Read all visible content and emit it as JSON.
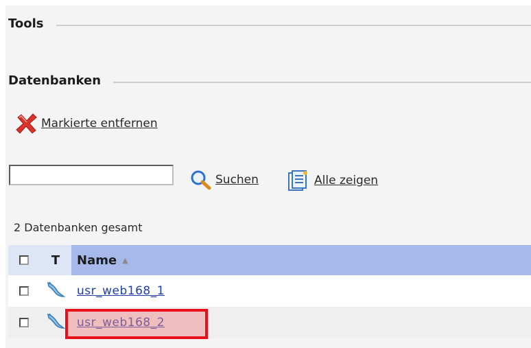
{
  "tools": {
    "title": "Tools"
  },
  "databases": {
    "title": "Datenbanken",
    "remove_label": "Markierte entfernen",
    "search": {
      "value": "",
      "placeholder": ""
    },
    "search_label": "Suchen",
    "show_all_label": "Alle zeigen",
    "count_text": "2 Datenbanken gesamt",
    "table": {
      "header": {
        "type": "T",
        "name": "Name",
        "sort": "▲"
      },
      "rows": [
        {
          "name": "usr_web168_1",
          "selected": false,
          "highlighted": false
        },
        {
          "name": "usr_web168_2",
          "selected": false,
          "highlighted": true
        }
      ]
    }
  },
  "colors": {
    "header_name_bg": "#a6b9ea",
    "link": "#1f3fa8",
    "highlight_border": "#e8111b"
  }
}
